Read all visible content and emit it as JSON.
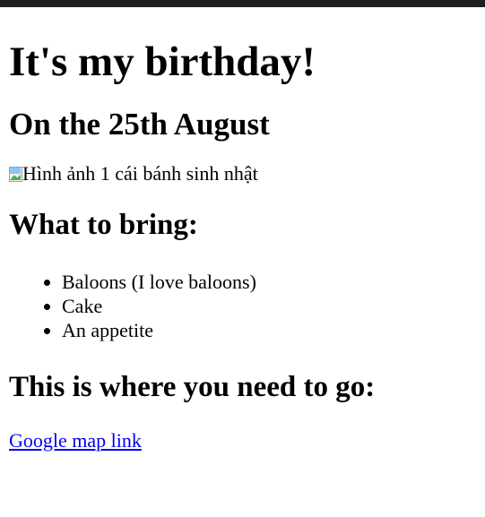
{
  "page": {
    "title": "It's my birthday!",
    "date_heading": "On the 25th August",
    "image": {
      "alt": "Hình ảnh 1 cái bánh sinh nhật",
      "icon": "broken-image-icon"
    },
    "bring_heading": "What to bring:",
    "bring_items": [
      "Baloons (I love baloons)",
      "Cake",
      "An appetite"
    ],
    "where_heading": "This is where you need to go:",
    "map_link_label": "Google map link"
  },
  "colors": {
    "top_bar": "#1f1f1f",
    "link": "#0000ee",
    "text": "#000000",
    "background": "#ffffff"
  }
}
